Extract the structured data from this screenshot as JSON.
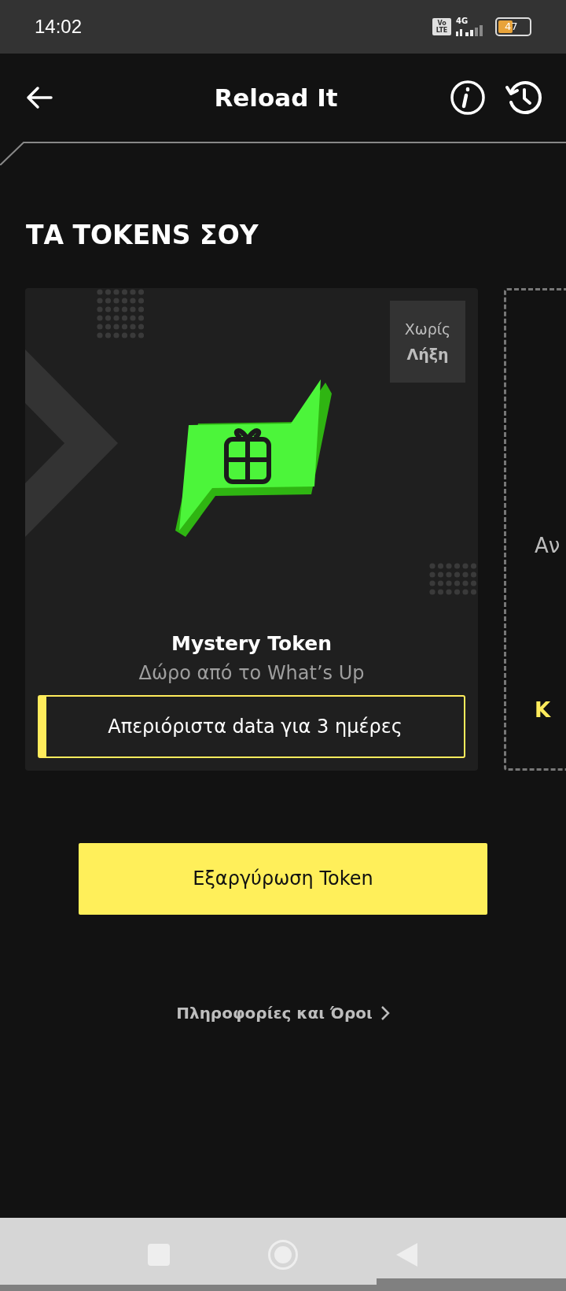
{
  "status_bar": {
    "time": "14:02",
    "volte_top": "Vo",
    "volte_bottom": "LTE",
    "network": "4G",
    "battery": "47"
  },
  "header": {
    "title": "Reload It"
  },
  "section_title": "ΤΑ TOKENS ΣΟΥ",
  "tokens": [
    {
      "kind": "token",
      "badge_top": "Χωρίς",
      "badge_bottom": "Λήξη",
      "title": "Mystery Token",
      "subtitle": "Δώρο από το What’s Up",
      "benefit": "Απεριόριστα data για 3 ημέρες"
    },
    {
      "kind": "next",
      "line_1": "Αν",
      "line_2": "Κ"
    }
  ],
  "redeem_button": "Εξαργύρωση Token",
  "info_link": "Πληροφορίες και Όροι"
}
